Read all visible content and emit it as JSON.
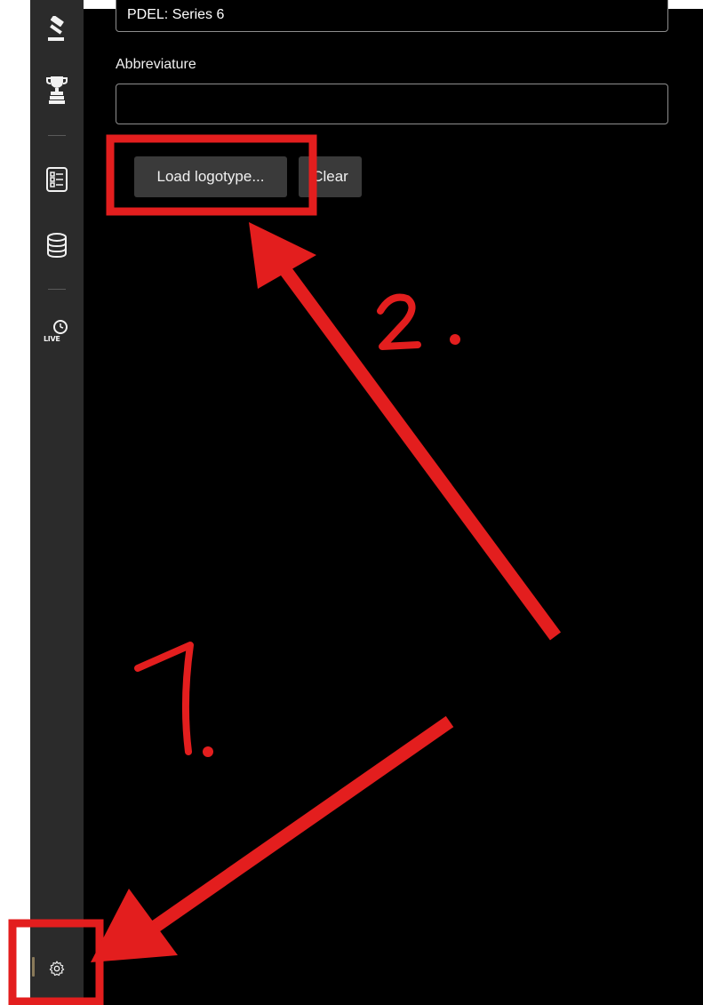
{
  "sidebar": {
    "items": [
      {
        "name": "gavel-icon"
      },
      {
        "name": "trophy-icon"
      },
      {
        "name": "checklist-icon"
      },
      {
        "name": "database-icon"
      },
      {
        "name": "live-clock-icon",
        "label": "LIVE"
      },
      {
        "name": "gear-icon"
      }
    ]
  },
  "form": {
    "name_value": "PDEL: Series 6",
    "abbreviature_label": "Abbreviature",
    "abbreviature_value": "",
    "load_button": "Load logotype...",
    "clear_button": "Clear"
  },
  "annotations": {
    "step1": "1.",
    "step2": "2.",
    "color": "#e31e1e"
  },
  "colors": {
    "sidebar_bg": "#2b2b2b",
    "main_bg": "#000000",
    "button_bg": "#3a3a3a"
  }
}
